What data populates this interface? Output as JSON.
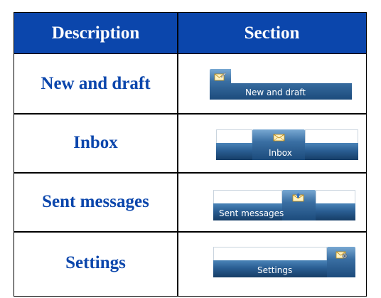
{
  "table": {
    "headers": {
      "description": "Description",
      "section": "Section"
    },
    "rows": [
      {
        "description": "New and draft",
        "tab_label": "New and draft",
        "icon": "new-draft-envelope-icon"
      },
      {
        "description": "Inbox",
        "tab_label": "Inbox",
        "icon": "inbox-envelope-icon"
      },
      {
        "description": "Sent messages",
        "tab_label": "Sent messages",
        "icon": "sent-envelope-icon"
      },
      {
        "description": "Settings",
        "tab_label": "Settings",
        "icon": "settings-envelope-icon"
      }
    ]
  },
  "colors": {
    "header_bg": "#0b46ac",
    "header_text": "#ffffff",
    "description_text": "#0b46ac",
    "tab_bar": "#2a5e93"
  }
}
